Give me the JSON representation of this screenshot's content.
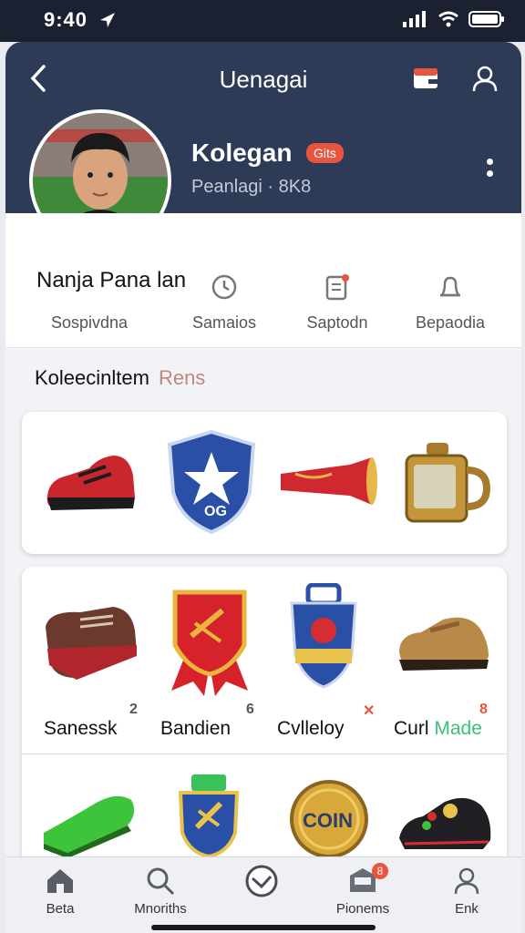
{
  "status_bar": {
    "time": "9:40"
  },
  "header": {
    "title": "Uenagai"
  },
  "profile": {
    "name": "Kolegan",
    "badge": "Gits",
    "subtitle": "Peanlagi · 8K8"
  },
  "stats": {
    "user_name": "Nanja Pana lan",
    "items": [
      {
        "label": "Sospivdna",
        "icon": "clock-icon"
      },
      {
        "label": "Samaios",
        "icon": "clock-icon"
      },
      {
        "label": "Saptodn",
        "icon": "clipboard-icon"
      },
      {
        "label": "Bepaodia",
        "icon": "bell-icon"
      }
    ]
  },
  "collection": {
    "title": "Koleecinltem",
    "subtitle": "Rens"
  },
  "items_row1": [
    {
      "icon": "red-sneaker-icon"
    },
    {
      "icon": "shield-star-icon",
      "text": "OG"
    },
    {
      "icon": "red-horn-icon"
    },
    {
      "icon": "gold-watch-icon"
    }
  ],
  "items_row2": [
    {
      "label": "Sanessk",
      "count": "2",
      "icon": "brown-boot-icon"
    },
    {
      "label": "Bandien",
      "count": "6",
      "icon": "ribbon-badge-icon"
    },
    {
      "label": "Cvlleloy",
      "count": "✕",
      "icon": "medal-crest-icon"
    },
    {
      "label": "Curl",
      "label_accent": "Made",
      "count": "8",
      "icon": "brown-shoe-icon"
    }
  ],
  "items_row3": [
    {
      "icon": "green-cleat-icon"
    },
    {
      "icon": "green-medal-icon"
    },
    {
      "icon": "gold-coin-icon",
      "text": "COIN"
    },
    {
      "icon": "black-sneaker-icon"
    }
  ],
  "bottom_nav": [
    {
      "label": "Beta",
      "icon": "home-icon"
    },
    {
      "label": "Mnoriths",
      "icon": "search-icon"
    },
    {
      "label": "",
      "icon": "compass-icon"
    },
    {
      "label": "Pionems",
      "icon": "inbox-icon",
      "badge": "8"
    },
    {
      "label": "Enk",
      "icon": "user-icon"
    }
  ],
  "colors": {
    "header": "#2e3b57",
    "accent": "#e8553c",
    "collection_subtitle": "#c0877a",
    "made_green": "#3cc07a"
  }
}
